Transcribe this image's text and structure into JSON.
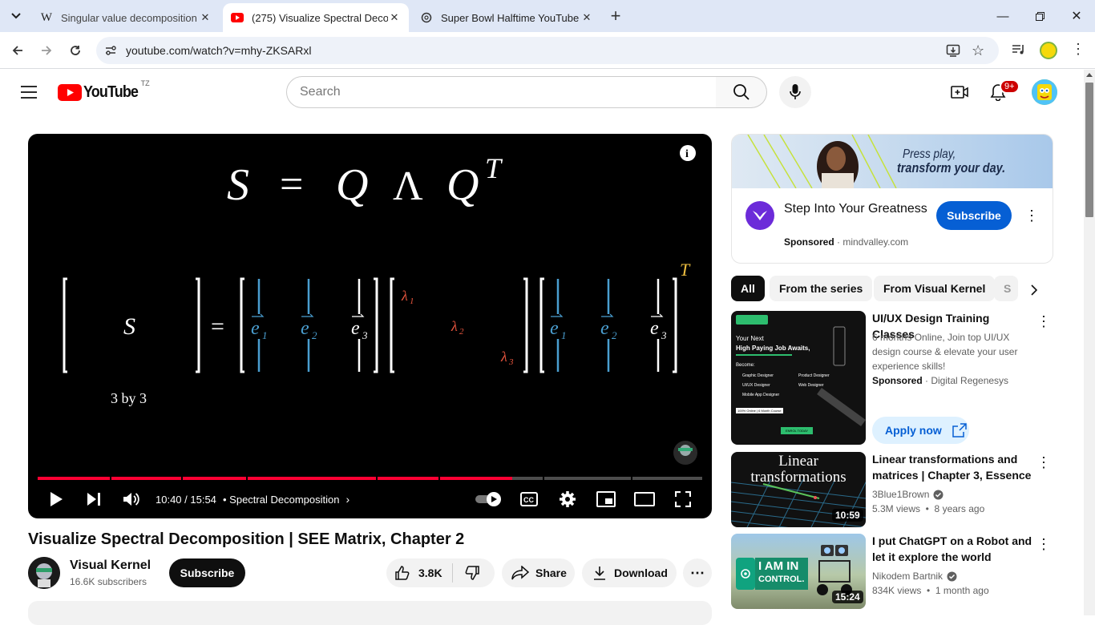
{
  "browser": {
    "tabs": [
      {
        "title": "Singular value decomposition -",
        "favicon": "W"
      },
      {
        "title": "(275) Visualize Spectral Decomp",
        "favicon": "youtube"
      },
      {
        "title": "Super Bowl Halftime YouTube",
        "favicon": "chatgpt"
      }
    ],
    "url": "youtube.com/watch?v=mhy-ZKSARxl"
  },
  "yt": {
    "logo_text": "YouTube",
    "country": "TZ",
    "search_placeholder": "Search",
    "notifications": "9+"
  },
  "player": {
    "formula": {
      "S": "S",
      "eq": "=",
      "Q": "Q",
      "Lambda": "Λ",
      "QT": "Q",
      "T": "T"
    },
    "matrix_S": "S",
    "size_label": "3 by 3",
    "e1": "e",
    "e2": "e",
    "e3": "e",
    "sub1": "1",
    "sub2": "2",
    "sub3": "3",
    "lambda1": "λ",
    "lambda2": "λ",
    "lambda3": "λ",
    "outer_T": "T",
    "time": "10:40 / 15:54",
    "chapter": "• Spectral Decomposition",
    "progress": 0.714
  },
  "video": {
    "title": "Visualize Spectral Decomposition | SEE Matrix, Chapter 2",
    "channel": "Visual Kernel",
    "subscribers": "16.6K subscribers",
    "subscribe": "Subscribe",
    "likes": "3.8K",
    "share": "Share",
    "download": "Download"
  },
  "ad": {
    "banner_line1": "Press play,",
    "banner_line2": "transform your day.",
    "title": "Step Into Your Greatness",
    "sponsored": "Sponsored",
    "domain": "mindvalley.com",
    "cta": "Subscribe"
  },
  "chips": [
    "All",
    "From the series",
    "From Visual Kernel",
    "S"
  ],
  "recs": [
    {
      "title": "UI/UX Design Training Classes",
      "desc": "6 months Online, Join top UI/UX design course & elevate your user experience skills!",
      "sponsored": "Sponsored",
      "advertiser": "Digital Regenesys",
      "cta": "Apply now",
      "thumb": {
        "line1": "Your Next",
        "line2": "High Paying Job Awaits,",
        "become": "Become:",
        "r1": "Graphic Designer",
        "r2": "Product Designer",
        "r3": "UI/UX Designer",
        "r4": "Web Designer",
        "r5": "Mobile App Designer",
        "tag": "100% Online | 6 Month Course",
        "enrol": "ENROL TODAY"
      }
    },
    {
      "title": "Linear transformations and matrices | Chapter 3, Essence ...",
      "channel": "3Blue1Brown",
      "meta": "5.3M views  •  8 years ago",
      "duration": "10:59",
      "thumb_line1": "Linear",
      "thumb_line2": "transformations"
    },
    {
      "title": "I put ChatGPT on a Robot and let it explore the world",
      "channel": "Nikodem Bartnik",
      "meta": "834K views  •  1 month ago",
      "duration": "15:24",
      "thumb_text1": "I AM IN",
      "thumb_text2": "CONTROL."
    }
  ],
  "colors": {
    "yt_red": "#ff0000",
    "sub_blue": "#065fd4",
    "progress_red": "#f03",
    "eig_blue": "#4a9ed0",
    "lambda_red": "#e8553e"
  }
}
